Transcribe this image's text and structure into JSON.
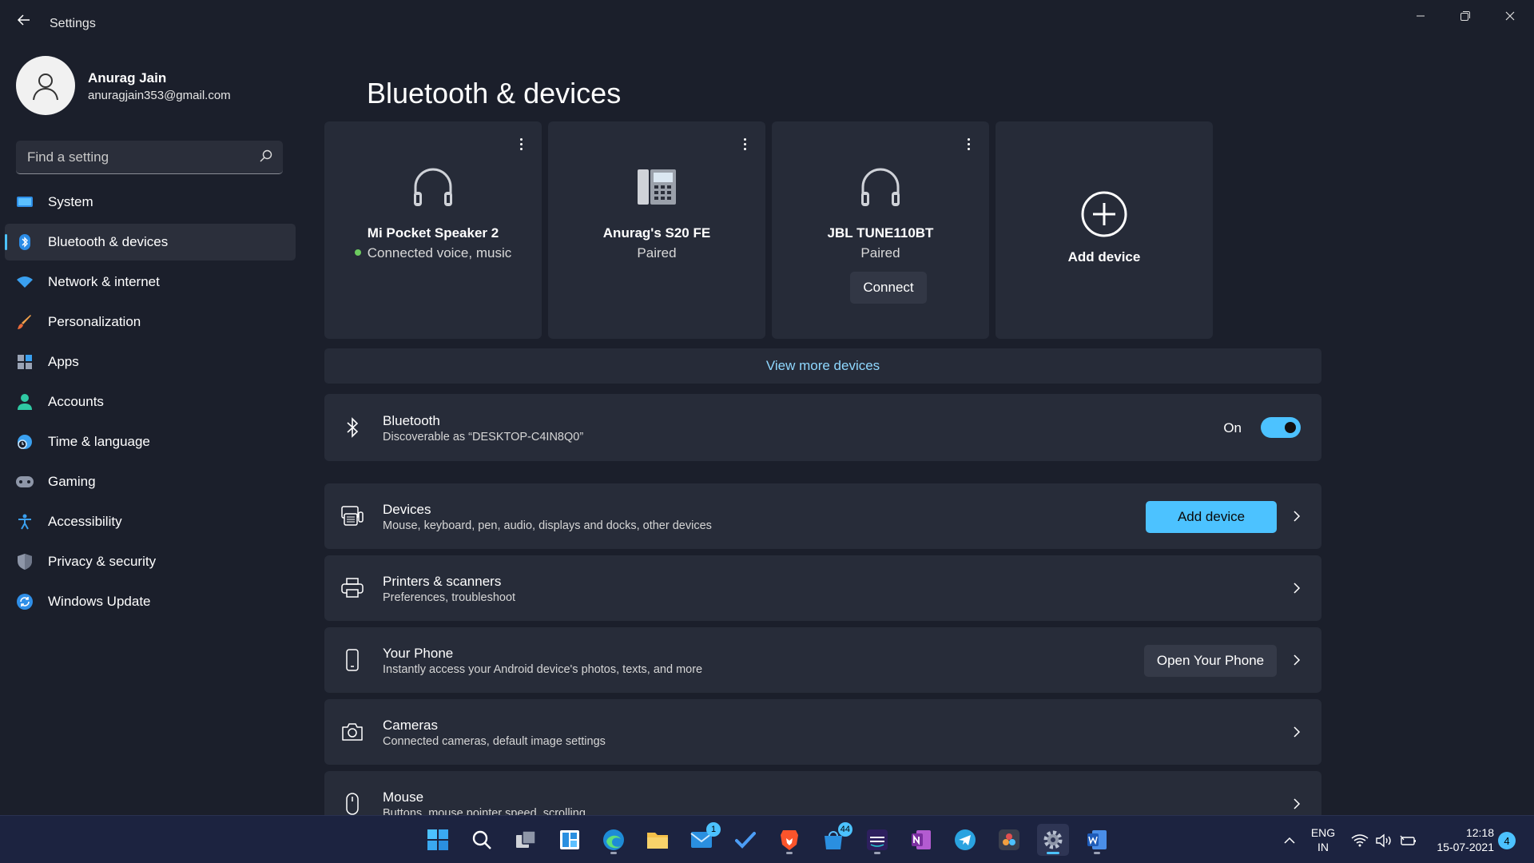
{
  "window": {
    "title": "Settings"
  },
  "profile": {
    "name": "Anurag Jain",
    "email": "anuragjain353@gmail.com"
  },
  "search": {
    "placeholder": "Find a setting"
  },
  "sidebar": {
    "items": [
      {
        "label": "System",
        "icon": "monitor-icon",
        "active": false
      },
      {
        "label": "Bluetooth & devices",
        "icon": "bluetooth-icon",
        "active": true
      },
      {
        "label": "Network & internet",
        "icon": "wifi-icon",
        "active": false
      },
      {
        "label": "Personalization",
        "icon": "brush-icon",
        "active": false
      },
      {
        "label": "Apps",
        "icon": "apps-icon",
        "active": false
      },
      {
        "label": "Accounts",
        "icon": "person-icon",
        "active": false
      },
      {
        "label": "Time & language",
        "icon": "globe-clock-icon",
        "active": false
      },
      {
        "label": "Gaming",
        "icon": "gamepad-icon",
        "active": false
      },
      {
        "label": "Accessibility",
        "icon": "accessibility-icon",
        "active": false
      },
      {
        "label": "Privacy & security",
        "icon": "shield-icon",
        "active": false
      },
      {
        "label": "Windows Update",
        "icon": "update-icon",
        "active": false
      }
    ]
  },
  "main": {
    "title": "Bluetooth & devices",
    "devices": [
      {
        "name": "Mi Pocket Speaker 2",
        "status": "Connected voice, music",
        "icon": "headphones-icon",
        "connected": true
      },
      {
        "name": "Anurag's S20 FE",
        "status": "Paired",
        "icon": "phone-device-icon",
        "connected": false
      },
      {
        "name": "JBL TUNE110BT",
        "status": "Paired",
        "icon": "headphones-icon",
        "connected": false,
        "action": "Connect"
      }
    ],
    "add_device_card": "Add device",
    "view_more": "View more devices",
    "bluetooth": {
      "title": "Bluetooth",
      "subtitle": "Discoverable as “DESKTOP-C4IN8Q0”",
      "state_label": "On",
      "enabled": true
    },
    "rows": [
      {
        "title": "Devices",
        "subtitle": "Mouse, keyboard, pen, audio, displays and docks, other devices",
        "button": "Add device"
      },
      {
        "title": "Printers & scanners",
        "subtitle": "Preferences, troubleshoot"
      },
      {
        "title": "Your Phone",
        "subtitle": "Instantly access your Android device's photos, texts, and more",
        "button": "Open Your Phone"
      },
      {
        "title": "Cameras",
        "subtitle": "Connected cameras, default image settings"
      },
      {
        "title": "Mouse",
        "subtitle": "Buttons, mouse pointer speed, scrolling"
      }
    ]
  },
  "taskbar": {
    "badges": {
      "mail": "1",
      "store": "44"
    },
    "language": {
      "line1": "ENG",
      "line2": "IN"
    },
    "clock": {
      "time": "12:18",
      "date": "15-07-2021"
    },
    "notifications": "4"
  },
  "colors": {
    "accent": "#4cc2ff",
    "background": "#1b1f2b",
    "card": "#272c39",
    "connected_dot": "#6ccb5f"
  }
}
